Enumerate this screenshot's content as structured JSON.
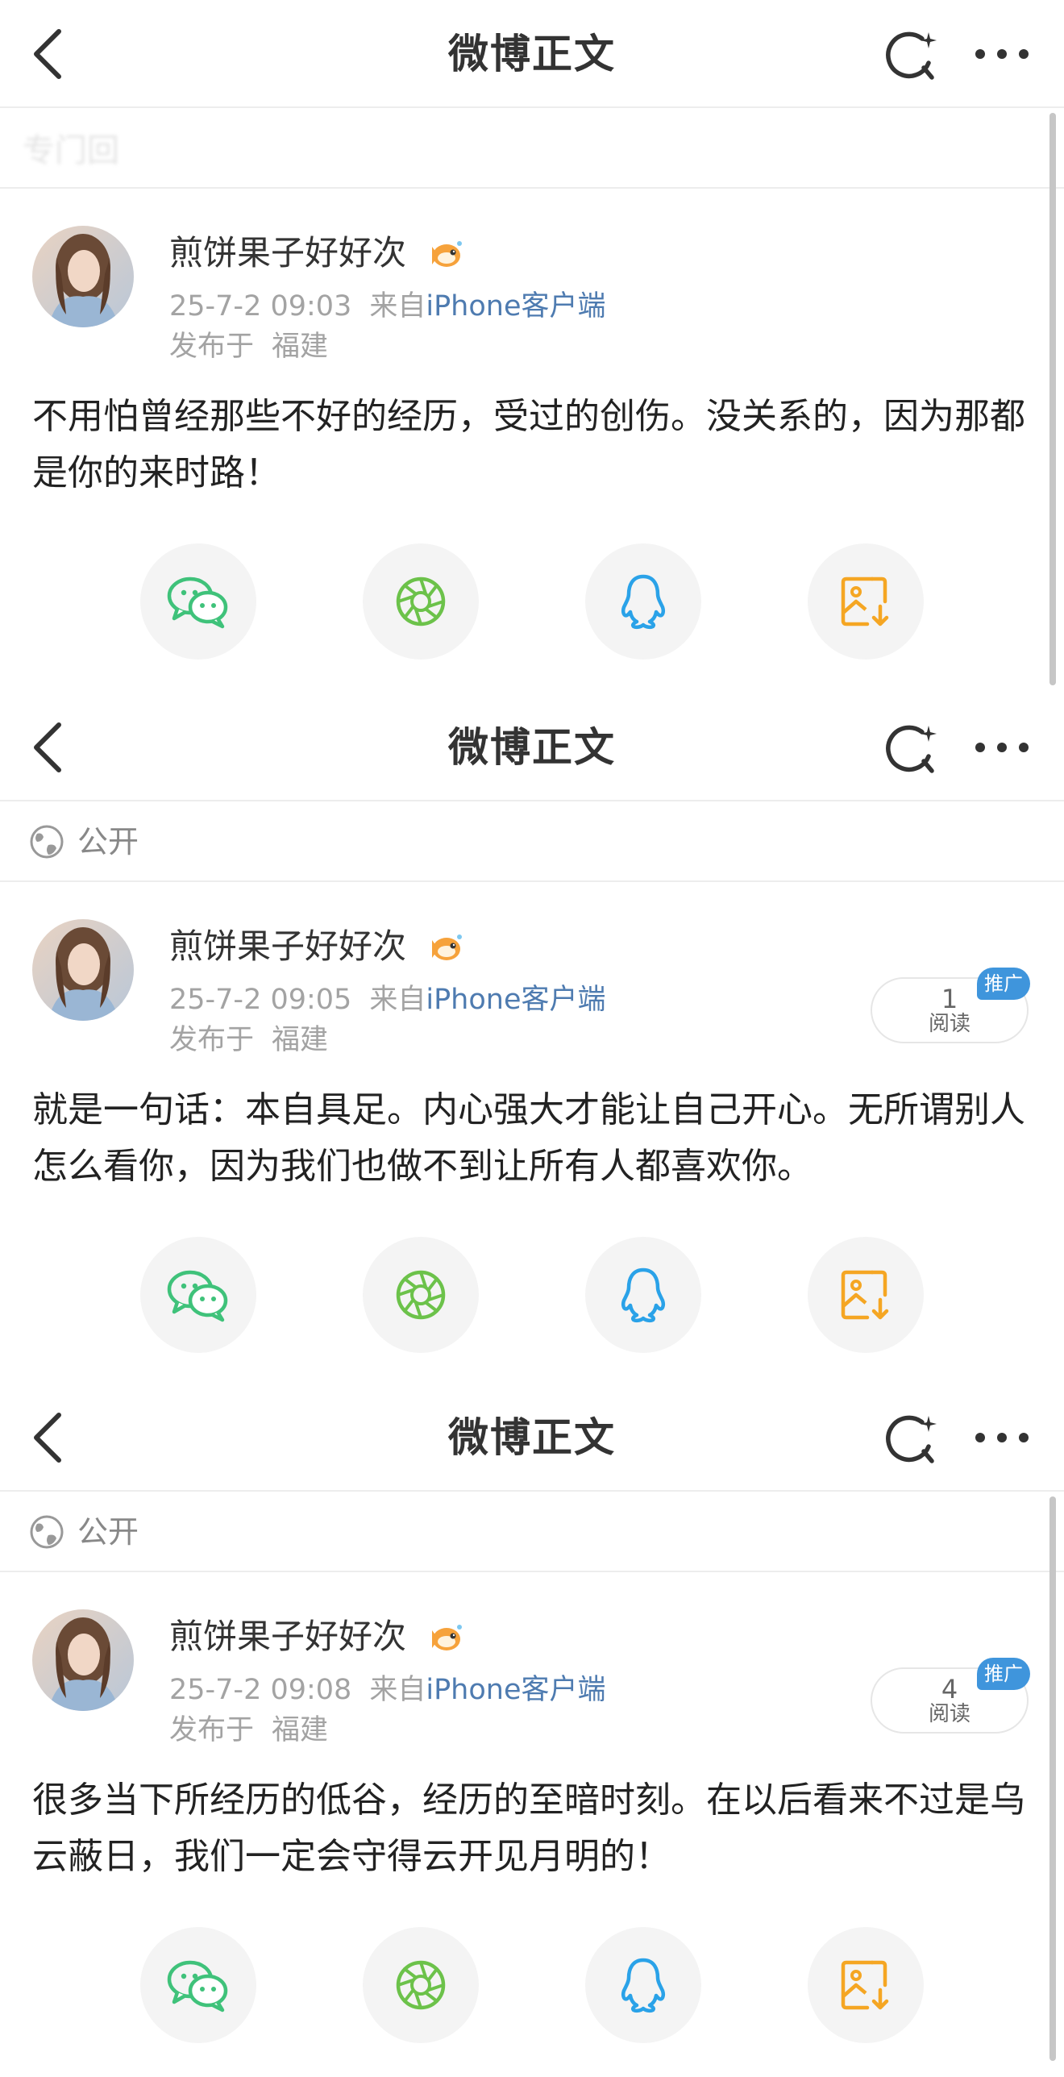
{
  "nav": {
    "title": "微博正文"
  },
  "panels": [
    {
      "visibility": "",
      "faded_text": "专门回",
      "post": {
        "username": "煎饼果子好好次",
        "time": "25-7-2 09:03",
        "source_prefix": "来自",
        "source": "iPhone客户端",
        "location_prefix": "发布于",
        "location": "福建",
        "text": "不用怕曾经那些不好的经历，受过的创伤。没关系的，因为那都是你的来时路！",
        "read_count": "",
        "read_label": "",
        "promo": ""
      }
    },
    {
      "visibility": "公开",
      "faded_text": "",
      "post": {
        "username": "煎饼果子好好次",
        "time": "25-7-2 09:05",
        "source_prefix": "来自",
        "source": "iPhone客户端",
        "location_prefix": "发布于",
        "location": "福建",
        "text": "就是一句话：本自具足。内心强大才能让自己开心。无所谓别人怎么看你，因为我们也做不到让所有人都喜欢你。",
        "read_count": "1",
        "read_label": "阅读",
        "promo": "推广"
      }
    },
    {
      "visibility": "公开",
      "faded_text": "",
      "post": {
        "username": "煎饼果子好好次",
        "time": "25-7-2 09:08",
        "source_prefix": "来自",
        "source": "iPhone客户端",
        "location_prefix": "发布于",
        "location": "福建",
        "text": "很多当下所经历的低谷，经历的至暗时刻。在以后看来不过是乌云蔽日，我们一定会守得云开见月明的！",
        "read_count": "4",
        "read_label": "阅读",
        "promo": "推广"
      }
    }
  ],
  "share_icons": [
    "wechat-icon",
    "moments-icon",
    "qq-icon",
    "save-image-icon"
  ],
  "colors": {
    "wechat": "#3fc27a",
    "moments": "#6cc24a",
    "qq": "#2aa2e8",
    "save_image": "#f5a623",
    "link": "#4e7bb0",
    "promo": "#3f95dc"
  }
}
